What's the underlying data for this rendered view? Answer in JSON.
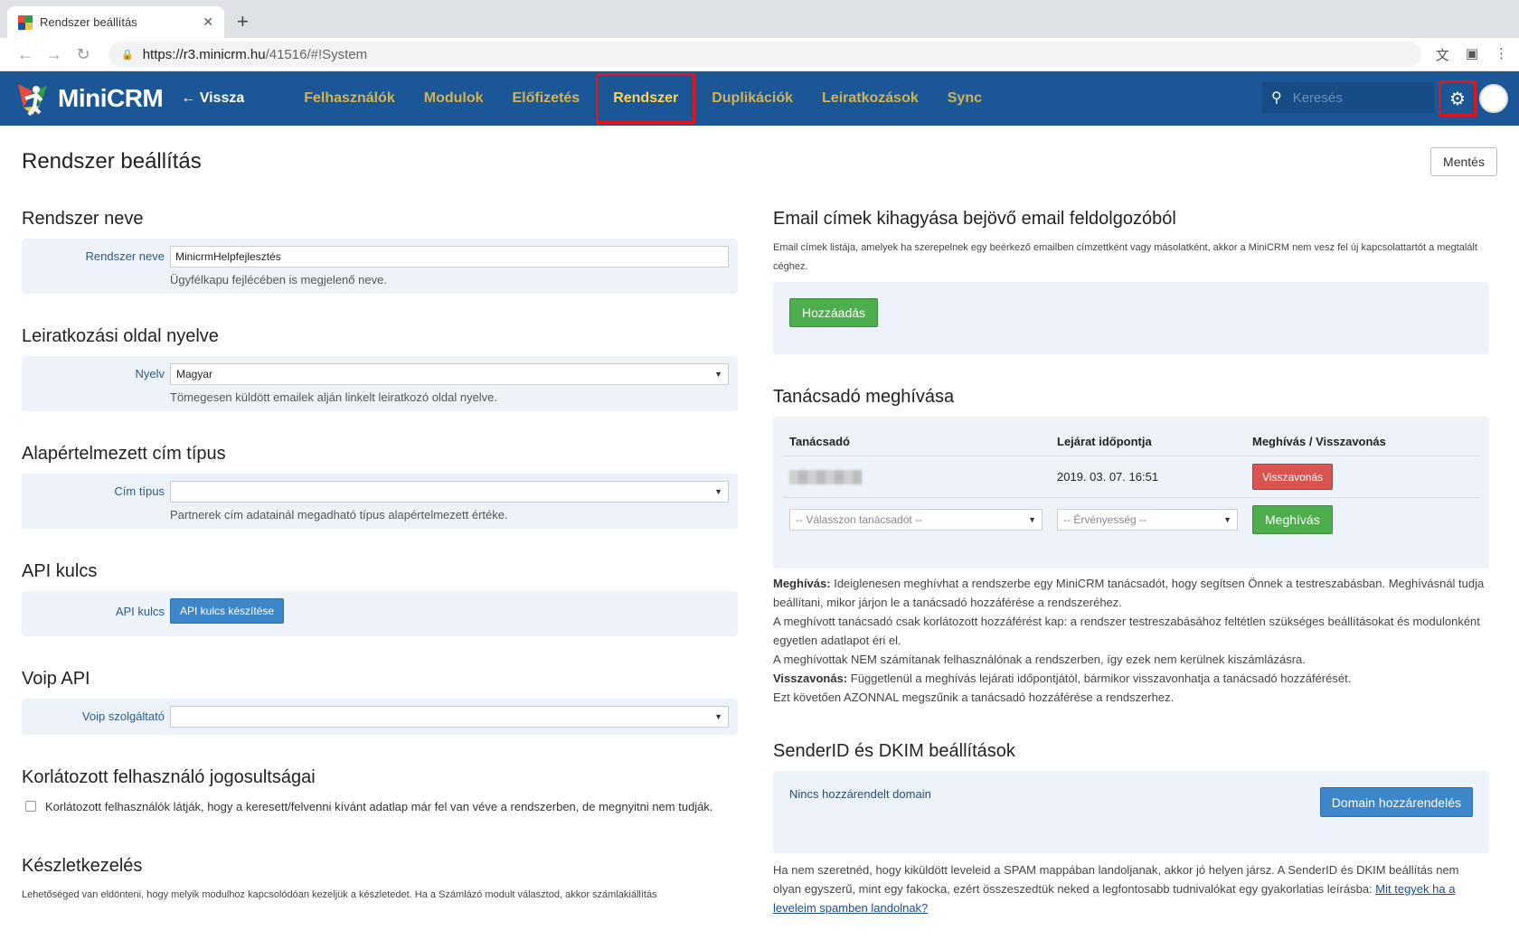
{
  "browser": {
    "tab_title": "Rendszer beállítás",
    "url_host": "https://r3.minicrm.hu",
    "url_path": "/41516/#!System"
  },
  "nav": {
    "logo": "MiniCRM",
    "back": "Vissza",
    "links": [
      "Felhasználók",
      "Modulok",
      "Előfizetés",
      "Rendszer",
      "Duplikációk",
      "Leiratkozások",
      "Sync"
    ],
    "active": "Rendszer",
    "search_placeholder": "Keresés"
  },
  "page": {
    "title": "Rendszer beállítás",
    "save": "Mentés"
  },
  "left": {
    "system_name": {
      "title": "Rendszer neve",
      "label": "Rendszer neve",
      "value": "MinicrmHelpfejlesztés",
      "help": "Ügyfélkapu fejlécében is megjelenő neve."
    },
    "unsub_lang": {
      "title": "Leiratkozási oldal nyelve",
      "label": "Nyelv",
      "value": "Magyar",
      "help": "Tömegesen küldött emailek alján linkelt leiratkozó oldal nyelve."
    },
    "address_type": {
      "title": "Alapértelmezett cím típus",
      "label": "Cím típus",
      "value": "",
      "help": "Partnerek cím adatainál megadható típus alapértelmezett értéke."
    },
    "api": {
      "title": "API kulcs",
      "label": "API kulcs",
      "button": "API kulcs készítése"
    },
    "voip": {
      "title": "Voip API",
      "label": "Voip szolgáltató",
      "value": ""
    },
    "restricted": {
      "title": "Korlátozott felhasználó jogosultságai",
      "text": "Korlátozott felhasználók látják, hogy a keresett/felvenni kívánt adatlap már fel van véve a rendszerben, de megnyitni nem tudják."
    },
    "stock": {
      "title": "Készletkezelés",
      "text": "Lehetőséged van eldönteni, hogy melyik modulhoz kapcsolódóan kezeljük a készletedet. Ha a Számlázó modult választod, akkor számlakiállítás"
    }
  },
  "right": {
    "email_skip": {
      "title": "Email címek kihagyása bejövő email feldolgozóból",
      "desc": "Email címek listája, amelyek ha szerepelnek egy beérkező emailben címzettként vagy másolatként, akkor a MiniCRM nem vesz fel új kapcsolattartót a megtalált céghez.",
      "add": "Hozzáadás"
    },
    "advisor": {
      "title": "Tanácsadó meghívása",
      "col1": "Tanácsadó",
      "col2": "Lejárat időpontja",
      "col3": "Meghívás / Visszavonás",
      "row_date": "2019. 03. 07. 16:51",
      "revoke": "Visszavonás",
      "select_advisor": "-- Válasszon tanácsadót --",
      "select_validity": "-- Érvényesség --",
      "invite": "Meghívás",
      "info_invite_label": "Meghívás:",
      "info_invite": "Ideiglenesen meghívhat a rendszerbe egy MiniCRM tanácsadót, hogy segítsen Önnek a testreszabásban. Meghívásnál tudja beállítani, mikor járjon le a tanácsadó hozzáférése a rendszeréhez.",
      "info_line2": "A meghívott tanácsadó csak korlátozott hozzáférést kap: a rendszer testreszabásához feltétlen szükséges beállításokat és modulonként egyetlen adatlapot éri el.",
      "info_line3": "A meghívottak NEM számítanak felhasználónak a rendszerben, így ezek nem kerülnek kiszámlázásra.",
      "info_revoke_label": "Visszavonás:",
      "info_revoke": "Függetlenül a meghívás lejárati időpontjától, bármikor visszavonhatja a tanácsadó hozzáférését.",
      "info_line5": "Ezt követően AZONNAL megszűnik a tanácsadó hozzáférése a rendszerhez."
    },
    "sender": {
      "title": "SenderID és DKIM beállítások",
      "no_domain": "Nincs hozzárendelt domain",
      "assign": "Domain hozzárendelés",
      "info": "Ha nem szeretnéd, hogy kiküldött leveleid a SPAM mappában landoljanak, akkor jó helyen jársz. A SenderID és DKIM beállítás nem olyan egyszerű, mint egy fakocka, ezért összeszedtük neked a legfontosabb tudnivalókat egy gyakorlatias leírásba:",
      "link": "Mit tegyek ha a leveleim spamben landolnak?"
    }
  },
  "colors": {
    "nav_bg": "#1b5797",
    "nav_link": "#f0c24a",
    "highlight": "#e3141b",
    "panel_bg": "#eef3f9",
    "green": "#4cae4c",
    "red": "#d9534f",
    "blue": "#3c86c9"
  }
}
